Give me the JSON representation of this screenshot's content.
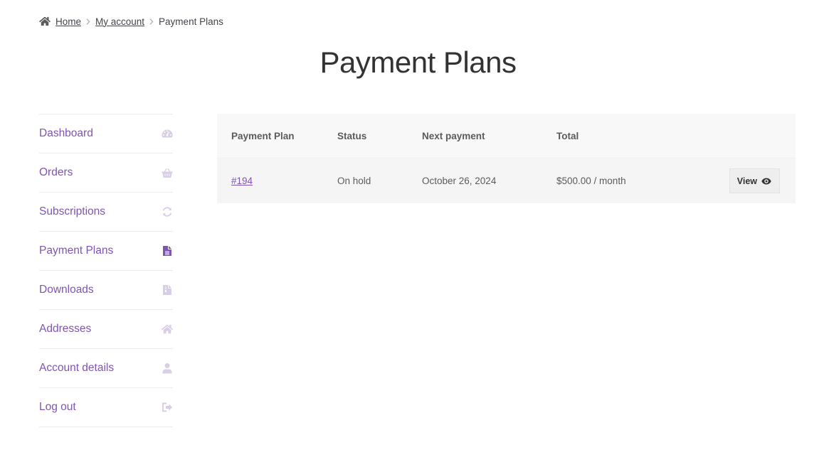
{
  "breadcrumb": {
    "home_label": "Home",
    "account_label": "My account",
    "current_label": "Payment Plans",
    "home_icon": "home-icon",
    "separator_icon": "chevron-right-icon"
  },
  "page": {
    "title": "Payment Plans"
  },
  "nav": {
    "items": [
      {
        "label": "Dashboard",
        "icon": "dashboard-icon"
      },
      {
        "label": "Orders",
        "icon": "basket-icon"
      },
      {
        "label": "Subscriptions",
        "icon": "refresh-icon"
      },
      {
        "label": "Payment Plans",
        "icon": "file-icon",
        "active": true
      },
      {
        "label": "Downloads",
        "icon": "file-archive-icon"
      },
      {
        "label": "Addresses",
        "icon": "home-icon"
      },
      {
        "label": "Account details",
        "icon": "user-icon"
      },
      {
        "label": "Log out",
        "icon": "logout-icon"
      }
    ]
  },
  "table": {
    "headers": [
      "Payment Plan",
      "Status",
      "Next payment",
      "Total"
    ],
    "rows": [
      {
        "plan": "#194",
        "status": "On hold",
        "next_payment": "October 26, 2024",
        "total": "$500.00 / month",
        "action_label": "View",
        "action_icon": "eye-icon"
      }
    ]
  },
  "colors": {
    "accent": "#7f54b3",
    "accent_muted": "#d8cee6",
    "text": "#43454b"
  }
}
